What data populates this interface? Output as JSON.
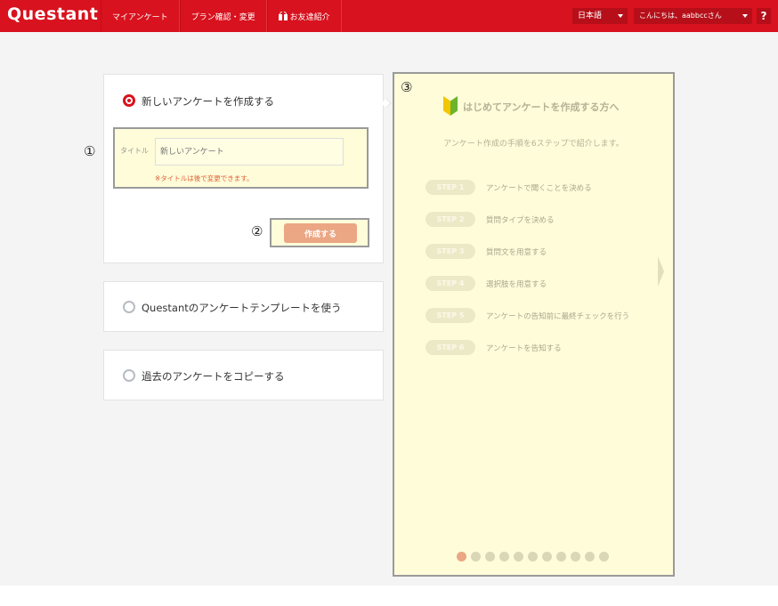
{
  "header": {
    "logo": "Questant",
    "nav": [
      {
        "label": "マイアンケート"
      },
      {
        "label": "プラン確認・変更"
      },
      {
        "label": "お友達紹介",
        "icon": "gift-icon"
      }
    ],
    "language": "日本語",
    "greeting": "こんにちは、aabbccさん",
    "help": "?"
  },
  "main": {
    "options": [
      {
        "label": "新しいアンケートを作成する",
        "selected": true
      },
      {
        "label": "Questantのアンケートテンプレートを使う",
        "selected": false
      },
      {
        "label": "過去のアンケートをコピーする",
        "selected": false
      }
    ],
    "form": {
      "title_label": "タイトル",
      "title_placeholder": "新しいアンケート",
      "note": "※タイトルは後で変更できます。",
      "create_button": "作成する"
    },
    "markers": [
      "①",
      "②",
      "③"
    ]
  },
  "guide": {
    "title": "はじめてアンケートを作成する方へ",
    "subtitle": "アンケート作成の手順を6ステップで紹介します。",
    "steps": [
      {
        "label": "STEP 1",
        "text": "アンケートで聞くことを決める"
      },
      {
        "label": "STEP 2",
        "text": "質問タイプを決める"
      },
      {
        "label": "STEP 3",
        "text": "質問文を用意する"
      },
      {
        "label": "STEP 4",
        "text": "選択肢を用意する"
      },
      {
        "label": "STEP 5",
        "text": "アンケートの告知前に最終チェックを行う"
      },
      {
        "label": "STEP 6",
        "text": "アンケートを告知する"
      }
    ],
    "page_count": 11,
    "current_page": 1
  },
  "colors": {
    "brand": "#d8121e",
    "button": "#eba684",
    "guide_bg": "#fefcd9"
  }
}
